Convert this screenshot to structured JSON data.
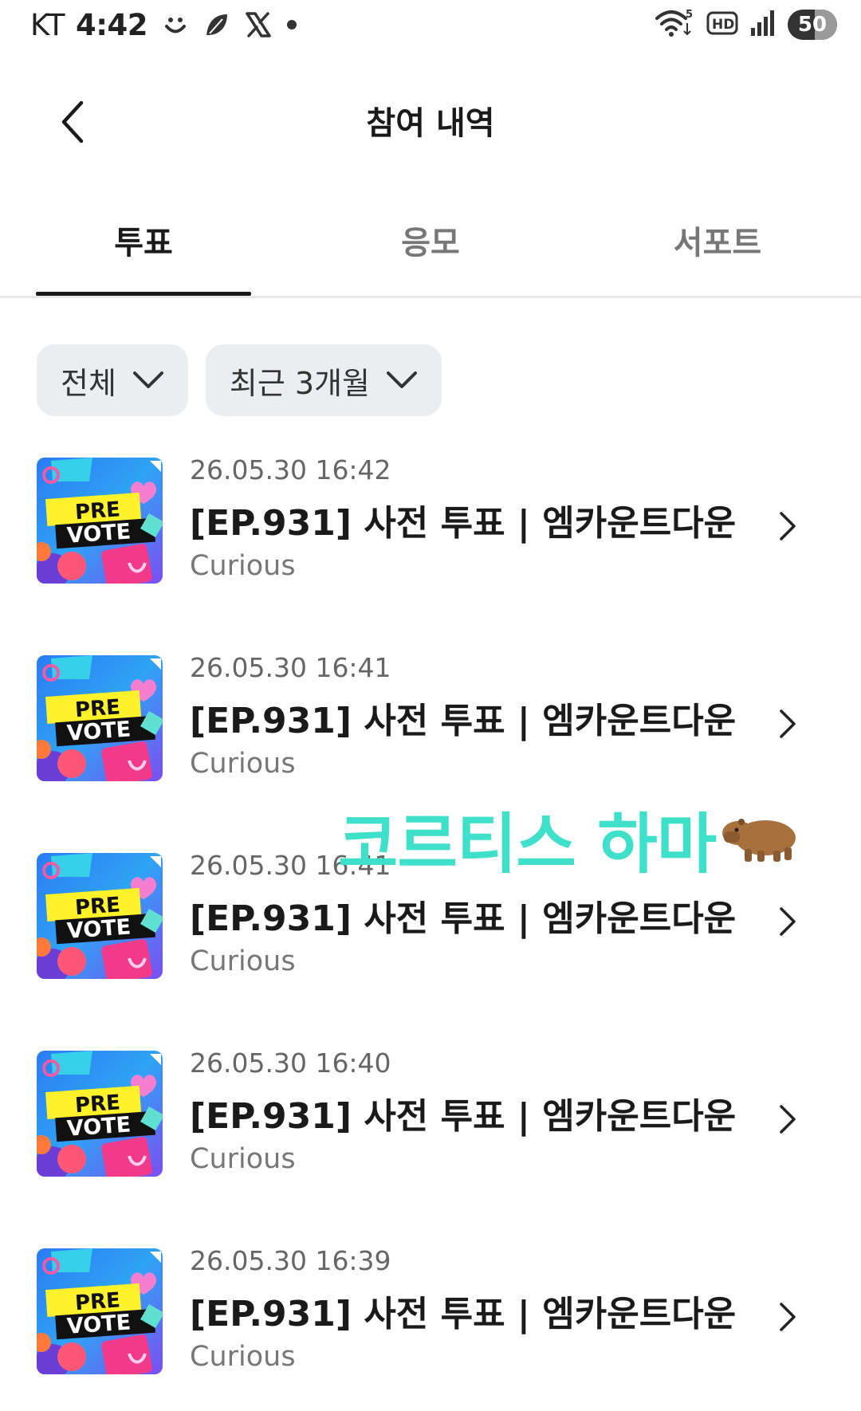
{
  "status_bar": {
    "carrier": "KT",
    "time": "4:42",
    "battery": "50",
    "icons": [
      "smile-icon",
      "leaf-icon",
      "x-logo-icon",
      "dot-icon",
      "wifi-icon",
      "hd-icon",
      "signal-icon"
    ]
  },
  "header": {
    "title": "참여 내역",
    "back_icon": "chevron-left-icon"
  },
  "tabs": [
    {
      "label": "투표",
      "active": true
    },
    {
      "label": "응모",
      "active": false
    },
    {
      "label": "서포트",
      "active": false
    }
  ],
  "filters": [
    {
      "label": "전체",
      "icon": "chevron-down-icon"
    },
    {
      "label": "최근 3개월",
      "icon": "chevron-down-icon"
    }
  ],
  "items": [
    {
      "date": "26.05.30 16:42",
      "title": "[EP.931] 사전 투표 | 엠카운트다운",
      "subtitle": "Curious",
      "thumb_text": [
        "PRE",
        "VOTE"
      ]
    },
    {
      "date": "26.05.30 16:41",
      "title": "[EP.931] 사전 투표 | 엠카운트다운",
      "subtitle": "Curious",
      "thumb_text": [
        "PRE",
        "VOTE"
      ]
    },
    {
      "date": "26.05.30 16:41",
      "title": "[EP.931] 사전 투표 | 엠카운트다운",
      "subtitle": "Curious",
      "thumb_text": [
        "PRE",
        "VOTE"
      ]
    },
    {
      "date": "26.05.30 16:40",
      "title": "[EP.931] 사전 투표 | 엠카운트다운",
      "subtitle": "Curious",
      "thumb_text": [
        "PRE",
        "VOTE"
      ]
    },
    {
      "date": "26.05.30 16:39",
      "title": "[EP.931] 사전 투표 | 엠카운트다운",
      "subtitle": "Curious",
      "thumb_text": [
        "PRE",
        "VOTE"
      ]
    }
  ],
  "overlay": {
    "text": "코르티스 하마",
    "emoji_icon": "capybara-icon"
  },
  "colors": {
    "active_tab": "#1a1a1a",
    "inactive_tab": "#777777",
    "chip_bg": "#ebedf0",
    "overlay_text": "#3ee0c9"
  }
}
